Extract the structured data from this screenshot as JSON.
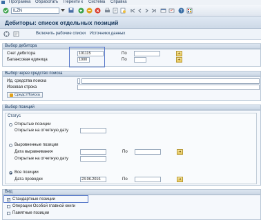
{
  "menubar": {
    "items": [
      "Программа",
      "Обработать",
      "Перейти к",
      "Система",
      "Справка"
    ]
  },
  "toolbar": {
    "command_value": "ILZN"
  },
  "title": "Дебиторы: список отдельных позиций",
  "app_toolbar": {
    "enable_worklists": "Включить рабочие списки",
    "data_sources": "Источники данных"
  },
  "debitor_selection": {
    "header": "Выбор дебитора",
    "account_label": "Счет дебитора",
    "account_value": "101115",
    "company_label": "Балансовая единица",
    "company_value": "1000",
    "to_label_1": "По",
    "to_label_2": "По"
  },
  "search_help": {
    "header": "Выбор через средство поиска",
    "id_label": "Ид. средства поиска",
    "string_label": "Исковая строка",
    "button_label": "СредстПоиска"
  },
  "item_selection": {
    "header": "Выбор позиций",
    "status_label": "Статус",
    "open_items": "Открытые позиции",
    "open_at_date": "Открытые на отчетную дату",
    "cleared_items": "Выровненные позиции",
    "clearing_date": "Дата выравнивания",
    "open_at_key_date": "Открытые на отчетную дату",
    "to_label": "По",
    "all_items": "Все позиции",
    "posting_date": "Дата проводки",
    "posting_date_value": "23.06.2016",
    "to_label_2": "По"
  },
  "view": {
    "header": "Вид",
    "standard_items": "Стандартные позиции",
    "special_gl": "Операции Особой главной книги",
    "noted_items": "Памятные позиции"
  },
  "colors": {
    "accent": "#5677c9",
    "header_text": "#15365b"
  }
}
